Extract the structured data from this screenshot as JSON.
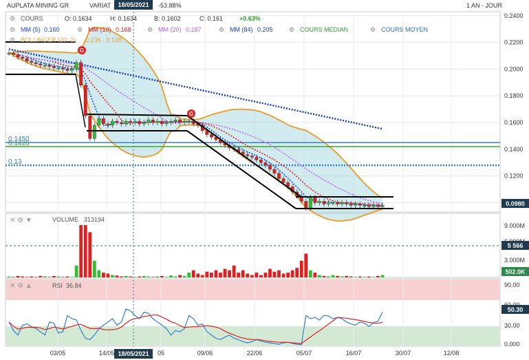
{
  "header": {
    "instrument": "AUPLATA MINING GR",
    "variation_label": "VARIAT",
    "variation_value": "-53.88%",
    "cursor_date": "18/05/2021",
    "period": "1 AN - JOUR"
  },
  "legend": {
    "cours": {
      "label": "COURS",
      "o": "O: 0.1634",
      "h": "H: 0.1634",
      "b": "B: 0.1602",
      "c": "C: 0.161",
      "change": "+0.63%"
    },
    "ma": [
      {
        "label": "MM (5)",
        "value": "0.160",
        "color": "#1a47d6"
      },
      {
        "label": "MM (10)",
        "value": "0.168",
        "color": "#d42020"
      },
      {
        "label": "MM (20)",
        "value": "0.187",
        "color": "#b566ee"
      },
      {
        "label": "MM (84)",
        "value": "0.205",
        "color": "#1a3fb3"
      },
      {
        "label": "COURS MEDIAN",
        "value": "",
        "color": "#3a9a3a"
      },
      {
        "label": "COURS MOYEN",
        "value": "",
        "color": "#2f6fd0"
      }
    ],
    "bollinger": {
      "label": "BOLLINGER (20, 2)",
      "value": "0.236 - 0.138",
      "color": "#e8a23a"
    }
  },
  "levels": [
    {
      "label": "0.1450",
      "value": 0.145,
      "color": "#2f7fd0",
      "style": "solid"
    },
    {
      "label": "0.1420",
      "value": 0.142,
      "color": "#3aa03a",
      "style": "solid"
    },
    {
      "label": "0.13",
      "value": 0.128,
      "color": "#2f7fd0",
      "style": "dotted"
    }
  ],
  "last_price_label": "0.0980",
  "volume": {
    "label": "VOLUME",
    "value": "313194",
    "ticks": [
      "9.000M",
      "6.000M",
      "3.000M"
    ],
    "marker": "5 566",
    "last": "502.0K"
  },
  "rsi": {
    "label": "RSI",
    "value": "36.84",
    "ticks": [
      "90.00",
      "60.00",
      "30.00",
      "0.000"
    ],
    "last": "50.30"
  },
  "x_ticks": [
    "03/05",
    "14/05",
    "18/05/2021",
    "05",
    "09/06",
    "22/06",
    "05/07",
    "16/07",
    "30/07",
    "12/08"
  ],
  "chart_data": {
    "type": "candlestick",
    "y_axis_ticks": [
      0.24,
      0.22,
      0.2,
      0.18,
      0.16,
      0.14,
      0.12,
      0.1
    ],
    "ylim": [
      0.093,
      0.243
    ],
    "closes": [
      0.212,
      0.211,
      0.209,
      0.208,
      0.206,
      0.205,
      0.204,
      0.203,
      0.203,
      0.202,
      0.201,
      0.201,
      0.2,
      0.199,
      0.2,
      0.205,
      0.188,
      0.165,
      0.148,
      0.158,
      0.163,
      0.159,
      0.158,
      0.161,
      0.16,
      0.159,
      0.161,
      0.16,
      0.161,
      0.159,
      0.16,
      0.162,
      0.16,
      0.161,
      0.159,
      0.16,
      0.161,
      0.162,
      0.16,
      0.161,
      0.161,
      0.159,
      0.158,
      0.154,
      0.151,
      0.149,
      0.147,
      0.145,
      0.143,
      0.141,
      0.14,
      0.138,
      0.136,
      0.135,
      0.134,
      0.132,
      0.13,
      0.128,
      0.125,
      0.122,
      0.118,
      0.115,
      0.112,
      0.108,
      0.105,
      0.101,
      0.096,
      0.104,
      0.1,
      0.101,
      0.099,
      0.1,
      0.1,
      0.099,
      0.1,
      0.099,
      0.098,
      0.099,
      0.098,
      0.098,
      0.097,
      0.098,
      0.097,
      0.098
    ],
    "volume_m": [
      0.2,
      0.1,
      0.3,
      0.2,
      0.1,
      0.2,
      0.1,
      0.3,
      0.2,
      0.1,
      0.3,
      0.2,
      0.1,
      0.2,
      0.1,
      2.5,
      11.0,
      11.0,
      9.5,
      3.5,
      1.5,
      1.0,
      0.8,
      0.5,
      0.4,
      0.2,
      0.3,
      0.2,
      0.1,
      0.2,
      0.3,
      0.2,
      0.1,
      0.2,
      0.3,
      0.1,
      0.4,
      0.2,
      0.5,
      0.3,
      1.0,
      1.5,
      0.8,
      0.5,
      1.2,
      1.0,
      1.5,
      1.0,
      1.8,
      1.5,
      2.5,
      1.0,
      1.5,
      0.8,
      0.5,
      1.0,
      0.5,
      1.0,
      1.8,
      1.2,
      1.5,
      0.8,
      1.0,
      1.5,
      2.0,
      3.5,
      5.0,
      1.5,
      1.0,
      0.5,
      0.3,
      0.2,
      0.5,
      0.3,
      0.2,
      0.3,
      0.2,
      0.1,
      0.2,
      0.1,
      0.2,
      0.1,
      0.3,
      0.5
    ],
    "volume_ylim": [
      0,
      11
    ],
    "rsi": [
      35,
      22,
      15,
      30,
      32,
      28,
      25,
      20,
      15,
      35,
      33,
      18,
      20,
      45,
      40,
      38,
      22,
      10,
      8,
      15,
      25,
      30,
      35,
      40,
      30,
      35,
      55,
      52,
      45,
      40,
      50,
      48,
      40,
      35,
      30,
      25,
      15,
      22,
      20,
      25,
      45,
      40,
      30,
      32,
      20,
      15,
      10,
      8,
      12,
      15,
      10,
      8,
      5,
      3,
      5,
      8,
      6,
      4,
      3,
      2,
      1,
      3,
      4,
      2,
      1,
      0,
      45,
      40,
      42,
      38,
      45,
      44,
      40,
      42,
      40,
      35,
      32,
      30,
      35,
      33,
      28,
      34,
      36,
      50
    ],
    "rsi_ylim": [
      0,
      100
    ]
  }
}
